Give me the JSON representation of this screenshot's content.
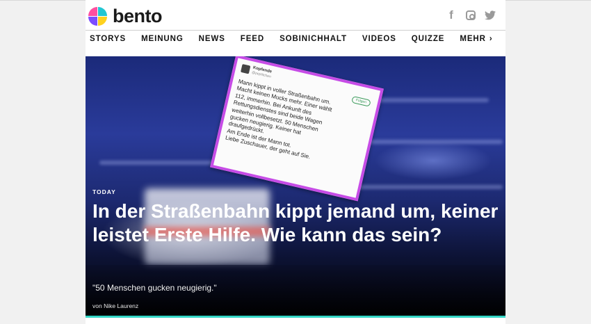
{
  "header": {
    "logo_text": "bento",
    "social": [
      {
        "icon": "facebook-icon",
        "glyph": "f"
      },
      {
        "icon": "instagram-icon",
        "glyph": ""
      },
      {
        "icon": "twitter-icon",
        "glyph": "🐦"
      }
    ]
  },
  "nav": {
    "items": [
      "STORYS",
      "MEINUNG",
      "NEWS",
      "FEED",
      "SOBINICHHALT",
      "VIDEOS",
      "QUIZZE",
      "MEHR"
    ],
    "more_chevron": "›"
  },
  "hero": {
    "kicker": "TODAY",
    "headline": "In der Straßenbahn kippt jemand um, keiner leistet Erste Hilfe. Wie kann das sein?",
    "subline": "\"50 Menschen gucken neugierig.\"",
    "author": "von Nike Laurenz",
    "accent_color": "#33d6c5"
  },
  "tweet": {
    "name": "Kopfende",
    "handle": "@peptitchen",
    "follow_label": "Folgen",
    "lines": [
      "Mann kippt in voller Straßenbahn um.",
      "Macht keinen Mucks mehr. Einer wählt",
      "112, immerhin. Bei Ankunft des",
      "Rettungsdienstes sind beide Wagen",
      "weiterhin vollbesetzt. 50 Menschen",
      "gucken neugierig. Keiner hat",
      "draufgedrückt.",
      "Am Ende ist der Mann tot.",
      "Liebe Zuschauer, der geht auf Sie."
    ],
    "border_color": "#c64ce6"
  }
}
